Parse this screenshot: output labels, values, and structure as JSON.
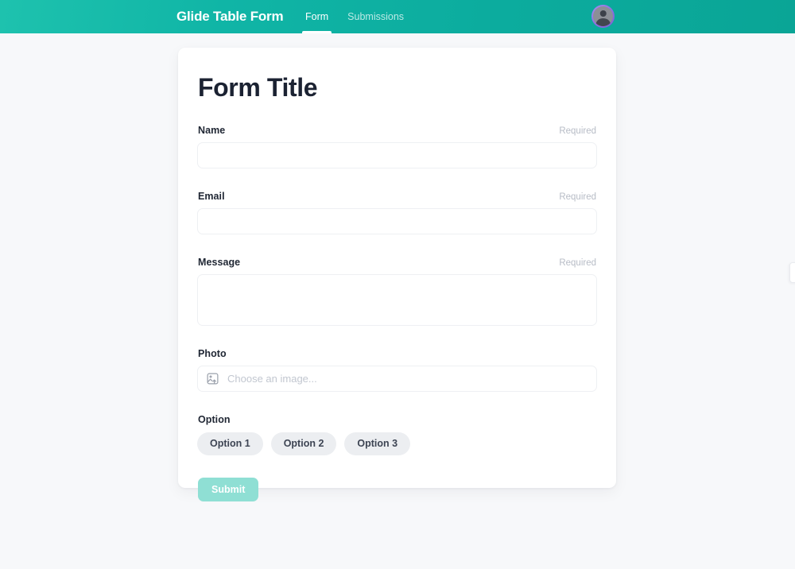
{
  "header": {
    "brand": "Glide Table Form",
    "tabs": [
      {
        "label": "Form",
        "active": true
      },
      {
        "label": "Submissions",
        "active": false
      }
    ],
    "avatar_name": "user-avatar",
    "gradient_from": "#1ec2ae",
    "gradient_to": "#0aa596"
  },
  "form": {
    "title": "Form Title",
    "required_label": "Required",
    "fields": [
      {
        "label": "Name",
        "required": "Required",
        "value": "",
        "placeholder": ""
      },
      {
        "label": "Email",
        "required": "Required",
        "value": "",
        "placeholder": ""
      },
      {
        "label": "Message",
        "required": "Required",
        "value": "",
        "placeholder": ""
      },
      {
        "label": "Photo",
        "required": "",
        "placeholder": "Choose an image...",
        "icon": "image-upload-icon"
      },
      {
        "label": "Option",
        "required": ""
      }
    ],
    "options": [
      {
        "label": "Option 1"
      },
      {
        "label": "Option 2"
      },
      {
        "label": "Option 3"
      }
    ],
    "submit_label": "Submit"
  },
  "colors": {
    "page_background": "#f7f8fa",
    "card_background": "#ffffff",
    "accent_teal": "#10b5a6",
    "submit_disabled": "#8fdfd4",
    "title_text": "#1b2232",
    "muted_text": "#b7bcc6",
    "pill_background": "#eceef1"
  }
}
